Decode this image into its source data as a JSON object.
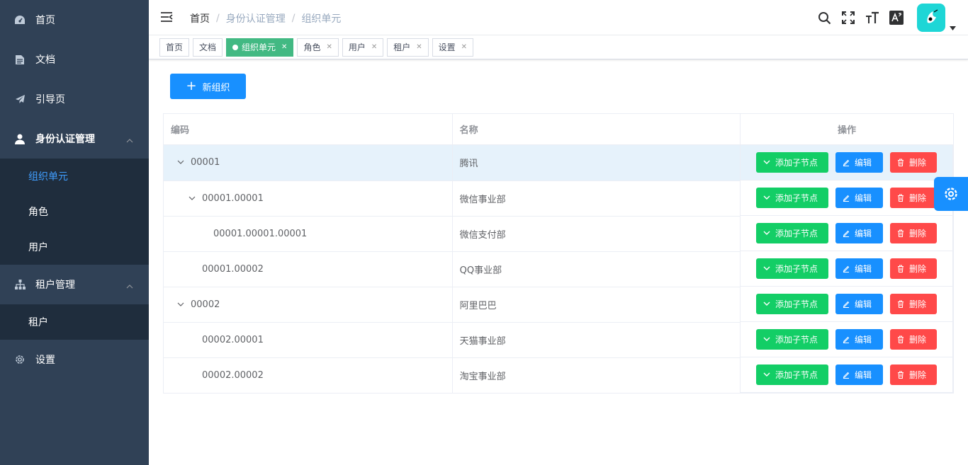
{
  "sidebar": {
    "items": [
      {
        "label": "首页",
        "icon": "dashboard-icon"
      },
      {
        "label": "文档",
        "icon": "document-icon"
      },
      {
        "label": "引导页",
        "icon": "paper-plane-icon"
      },
      {
        "label": "身份认证管理",
        "icon": "user-icon",
        "children": [
          "组织单元",
          "角色",
          "用户"
        ],
        "active_child": "组织单元"
      },
      {
        "label": "租户管理",
        "icon": "sitemap-icon",
        "children": [
          "租户"
        ]
      },
      {
        "label": "设置",
        "icon": "gear-icon"
      }
    ]
  },
  "breadcrumb": [
    "首页",
    "身份认证管理",
    "组织单元"
  ],
  "tags": [
    {
      "label": "首页",
      "closable": false,
      "active": false
    },
    {
      "label": "文档",
      "closable": false,
      "active": false
    },
    {
      "label": "组织单元",
      "closable": true,
      "active": true
    },
    {
      "label": "角色",
      "closable": true,
      "active": false
    },
    {
      "label": "用户",
      "closable": true,
      "active": false
    },
    {
      "label": "租户",
      "closable": true,
      "active": false
    },
    {
      "label": "设置",
      "closable": true,
      "active": false
    }
  ],
  "toolbar": {
    "new_button": "新组织"
  },
  "table": {
    "headers": {
      "code": "编码",
      "name": "名称",
      "ops": "操作"
    },
    "rows": [
      {
        "code": "00001",
        "name": "腾讯",
        "level": 0,
        "expandable": true,
        "highlight": true
      },
      {
        "code": "00001.00001",
        "name": "微信事业部",
        "level": 1,
        "expandable": true
      },
      {
        "code": "00001.00001.00001",
        "name": "微信支付部",
        "level": 2,
        "expandable": false
      },
      {
        "code": "00001.00002",
        "name": "QQ事业部",
        "level": 1,
        "expandable": false
      },
      {
        "code": "00002",
        "name": "阿里巴巴",
        "level": 0,
        "expandable": true
      },
      {
        "code": "00002.00001",
        "name": "天猫事业部",
        "level": 1,
        "expandable": false
      },
      {
        "code": "00002.00002",
        "name": "淘宝事业部",
        "level": 1,
        "expandable": false
      }
    ],
    "actions": {
      "add": "添加子节点",
      "edit": "编辑",
      "delete": "删除"
    }
  },
  "colors": {
    "sidebar_bg": "#304156",
    "submenu_bg": "#1f2d3d",
    "active": "#409eff",
    "primary": "#1890ff",
    "success": "#13ce66",
    "danger": "#ff4949",
    "tag_active": "#42b983"
  }
}
